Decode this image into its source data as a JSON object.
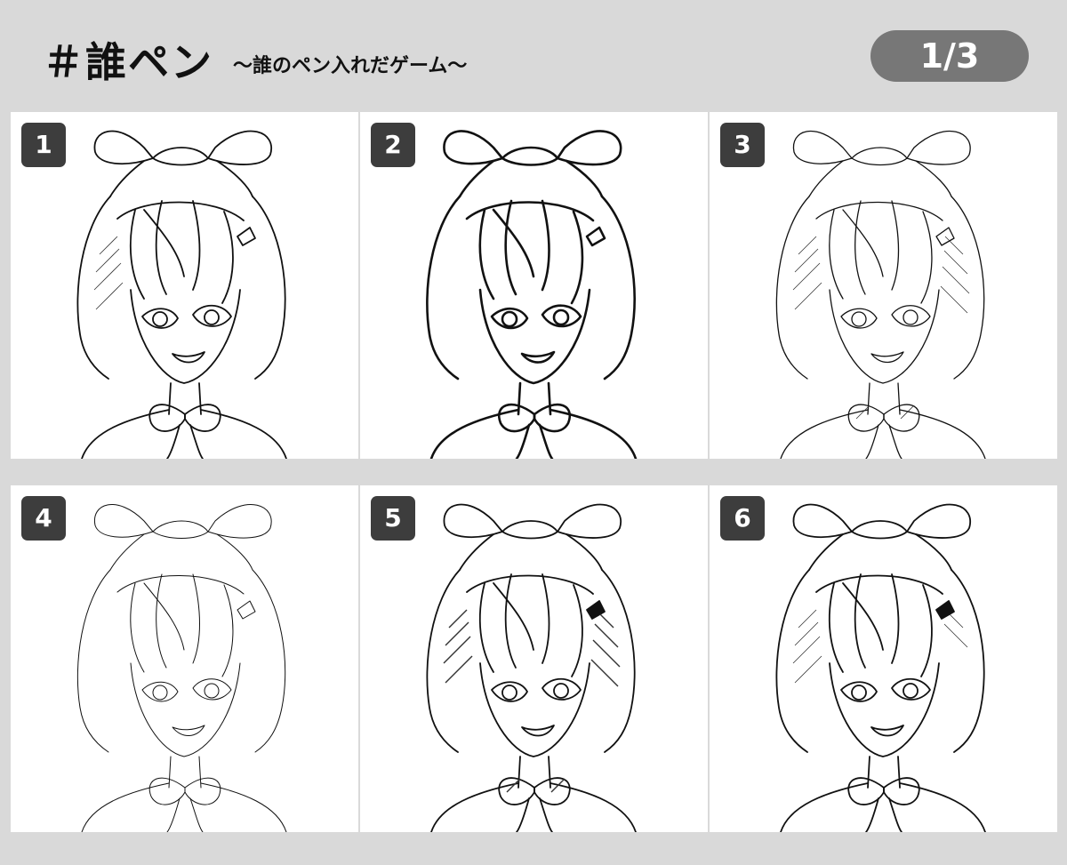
{
  "header": {
    "title": "＃誰ペン",
    "subtitle": "〜誰のペン入れだゲーム〜",
    "page_indicator": "1/3"
  },
  "panels": [
    {
      "number": "1",
      "line_weight": "medium",
      "shading": "light"
    },
    {
      "number": "2",
      "line_weight": "thick",
      "shading": "none"
    },
    {
      "number": "3",
      "line_weight": "fine",
      "shading": "hatched"
    },
    {
      "number": "4",
      "line_weight": "thin",
      "shading": "none"
    },
    {
      "number": "5",
      "line_weight": "medium",
      "shading": "dense"
    },
    {
      "number": "6",
      "line_weight": "medium",
      "shading": "accent"
    }
  ],
  "colors": {
    "background": "#d9d9d9",
    "badge": "#777777",
    "number_tag": "#3d3d3d"
  }
}
